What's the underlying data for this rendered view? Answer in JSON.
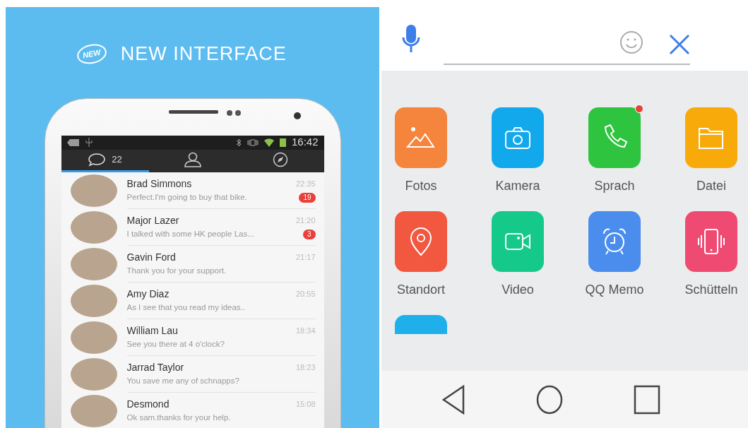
{
  "promo": {
    "badge": "NEW",
    "heading": "NEW INTERFACE"
  },
  "status_bar": {
    "time": "16:42"
  },
  "tabs": [
    {
      "kind": "chats",
      "count": "22",
      "selected": true
    },
    {
      "kind": "contacts",
      "selected": false
    },
    {
      "kind": "discover",
      "selected": false
    }
  ],
  "conversations": [
    {
      "name": "Brad Simmons",
      "message": "Perfect.I'm going to buy that bike.",
      "time": "22:35",
      "unread": "19"
    },
    {
      "name": "Major Lazer",
      "message": "I talked with some HK people Las...",
      "time": "21:20",
      "unread": "3"
    },
    {
      "name": "Gavin Ford",
      "message": "Thank you for your support.",
      "time": "21:17"
    },
    {
      "name": "Amy Diaz",
      "message": "As I see that you read my ideas..",
      "time": "20:55"
    },
    {
      "name": "William Lau",
      "message": "See you there at 4 o'clock?",
      "time": "18:34"
    },
    {
      "name": "Jarrad Taylor",
      "message": "You save me any of schnapps?",
      "time": "18:23"
    },
    {
      "name": "Desmond",
      "message": "Ok sam.thanks for your help.",
      "time": "15:08"
    }
  ],
  "apps": [
    {
      "kind": "full",
      "label": "Fotos",
      "color": "#f5843c",
      "notification": false
    },
    {
      "kind": "full",
      "label": "Kamera",
      "color": "#12a9ec",
      "notification": false
    },
    {
      "kind": "full",
      "label": "Sprach",
      "color": "#2fc43f",
      "notification": true
    },
    {
      "kind": "full",
      "label": "Datei",
      "color": "#f8aa0a",
      "notification": false
    },
    {
      "kind": "full",
      "label": "Standort",
      "color": "#f2573f",
      "notification": false
    },
    {
      "kind": "full",
      "label": "Video",
      "color": "#14c98a",
      "notification": false
    },
    {
      "kind": "full",
      "label": "QQ Memo",
      "color": "#4a8ded",
      "notification": false
    },
    {
      "kind": "full",
      "label": "Schütteln",
      "color": "#ee4a72",
      "notification": false
    },
    {
      "kind": "partial",
      "color": "#1fb0ec"
    }
  ]
}
